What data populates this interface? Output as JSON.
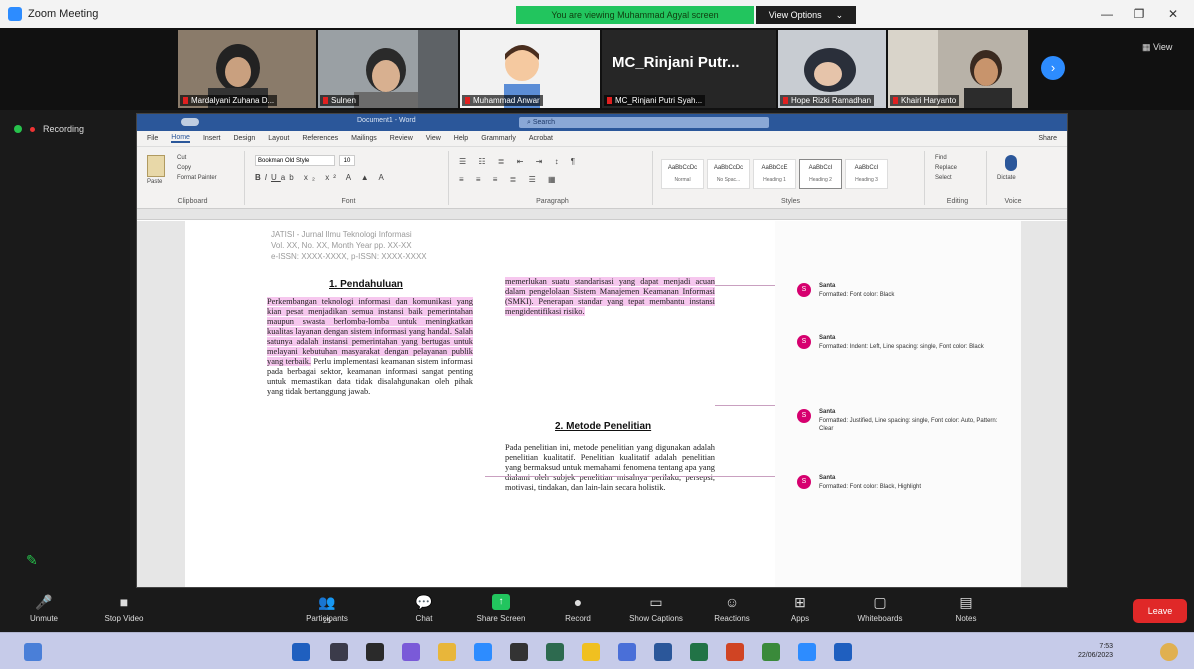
{
  "window": {
    "title": "Zoom Meeting",
    "minimize": "—",
    "restore": "❐",
    "close": "✕"
  },
  "share_banner": {
    "text": "You are viewing Muhammad Agyal  screen",
    "view_options": "View Options"
  },
  "participants": [
    {
      "name": "Mardalyani Zuhana D..."
    },
    {
      "name": "Sulnen"
    },
    {
      "name": "Muhammad Anwar"
    },
    {
      "name": "MC_Rinjani Putri Syah...",
      "display": "MC_Rinjani  Putr..."
    },
    {
      "name": "Hope Rizki Ramadhan"
    },
    {
      "name": "Khairi Haryanto"
    }
  ],
  "view_label": "View",
  "recording": {
    "label": "Recording"
  },
  "word": {
    "title": "Document1 - Word",
    "search": "Search",
    "tabs": [
      "File",
      "Home",
      "Insert",
      "Design",
      "Layout",
      "References",
      "Mailings",
      "Review",
      "View",
      "Help",
      "Grammarly",
      "Acrobat"
    ],
    "active_tab": "Home",
    "share": "Share",
    "clipboard": {
      "paste": "Paste",
      "cut": "Cut",
      "copy": "Copy",
      "format_painter": "Format Painter",
      "label": "Clipboard"
    },
    "font": {
      "name": "Bookman Old Style",
      "size": "10",
      "label": "Font"
    },
    "paragraph": {
      "label": "Paragraph"
    },
    "styles": {
      "items": [
        {
          "preview": "AaBbCcDc",
          "name": "Normal"
        },
        {
          "preview": "AaBbCcDc",
          "name": "No Spac..."
        },
        {
          "preview": "AaBbCcE",
          "name": "Heading 1"
        },
        {
          "preview": "AaBbCcI",
          "name": "Heading 2"
        },
        {
          "preview": "AaBbCcI",
          "name": "Heading 3"
        }
      ],
      "label": "Styles"
    },
    "editing": {
      "find": "Find",
      "replace": "Replace",
      "select": "Select",
      "label": "Editing"
    },
    "dictate": {
      "label": "Dictate",
      "group": "Voice"
    }
  },
  "document": {
    "header": [
      "JATISI - Jurnal Ilmu Teknologi Informasi",
      "Vol. XX, No. XX, Month Year pp. XX-XX",
      "e-ISSN: XXXX-XXXX, p-ISSN: XXXX-XXXX"
    ],
    "section1": "1.  Pendahuluan",
    "section2": "2.  Metode Penelitian",
    "col1_highlight": "Perkembangan teknologi informasi dan komunikasi yang kian pesat menjadikan semua instansi baik pemerintahan maupun swasta berlomba-lomba untuk meningkatkan kualitas layanan dengan sistem informasi yang handal. Salah satunya adalah instansi pemerintahan yang bertugas untuk melayani kebutuhan masyarakat dengan pelayanan publik yang terbaik.",
    "col1_rest": "Perlu implementasi keamanan sistem informasi pada berbagai sektor, keamanan informasi sangat penting untuk memastikan data tidak disalahgunakan oleh pihak yang tidak bertanggung jawab.",
    "col2_highlight": "memerlukan suatu standarisasi yang dapat menjadi acuan dalam pengelolaan Sistem Manajemen Keamanan Informasi (SMKI). Penerapan standar yang tepat membantu instansi mengidentifikasi risiko.",
    "col2_rest": "Pada penelitian ini, metode penelitian yang digunakan adalah penelitian kualitatif. Penelitian kualitatif adalah penelitian yang bermaksud untuk memahami fenomena tentang apa yang dialami oleh subjek penelitian misalnya perilaku, persepsi, motivasi, tindakan, dan lain-lain secara holistik."
  },
  "comments": [
    {
      "author": "Santa",
      "text": "Formatted: Font color: Black"
    },
    {
      "author": "Santa",
      "text": "Formatted: Indent: Left, Line spacing: single, Font color: Black"
    },
    {
      "author": "Santa",
      "text": "Formatted: Justified, Line spacing: single, Font color: Auto, Pattern: Clear"
    },
    {
      "author": "Santa",
      "text": "Formatted: Font color: Black, Highlight"
    }
  ],
  "toolbar": {
    "unmute": "Unmute",
    "stop_video": "Stop Video",
    "participants": "Participants",
    "participants_count": "25",
    "chat": "Chat",
    "share_screen": "Share Screen",
    "record": "Record",
    "show_captions": "Show Captions",
    "reactions": "Reactions",
    "apps": "Apps",
    "whiteboards": "Whiteboards",
    "notes": "Notes",
    "leave": "Leave"
  },
  "taskbar": {
    "clock_time": "7:53",
    "clock_date": "22/06/2023"
  }
}
